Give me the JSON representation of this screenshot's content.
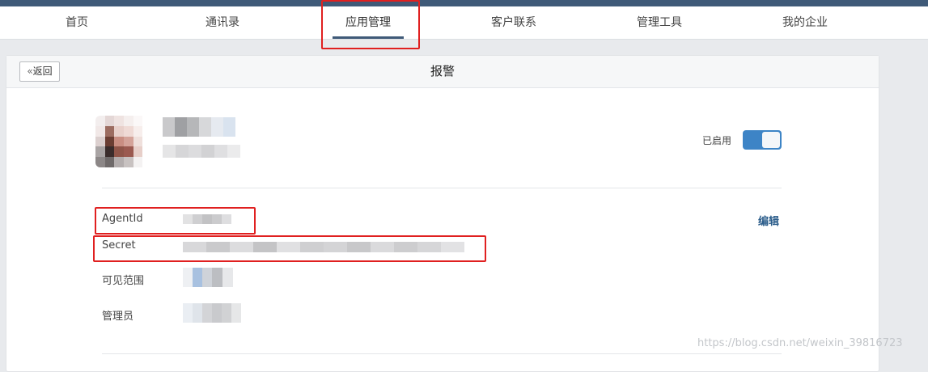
{
  "nav": {
    "items": [
      {
        "label": "首页"
      },
      {
        "label": "通讯录"
      },
      {
        "label": "应用管理"
      },
      {
        "label": "客户联系"
      },
      {
        "label": "管理工具"
      },
      {
        "label": "我的企业"
      }
    ],
    "active_index": 2
  },
  "header": {
    "back_label": "返回",
    "title": "报警"
  },
  "app": {
    "status_label": "已启用",
    "enabled": true
  },
  "fields": {
    "agentid_label": "AgentId",
    "secret_label": "Secret",
    "visible_scope_label": "可见范围",
    "admin_label": "管理员",
    "edit_label": "编辑"
  },
  "watermark": "https://blog.csdn.net/weixin_39816723",
  "colors": {
    "accent": "#3f5a78",
    "toggle": "#3d84c6",
    "highlight": "#e02020"
  },
  "icons": {
    "back": "double-chevron-left-icon"
  }
}
